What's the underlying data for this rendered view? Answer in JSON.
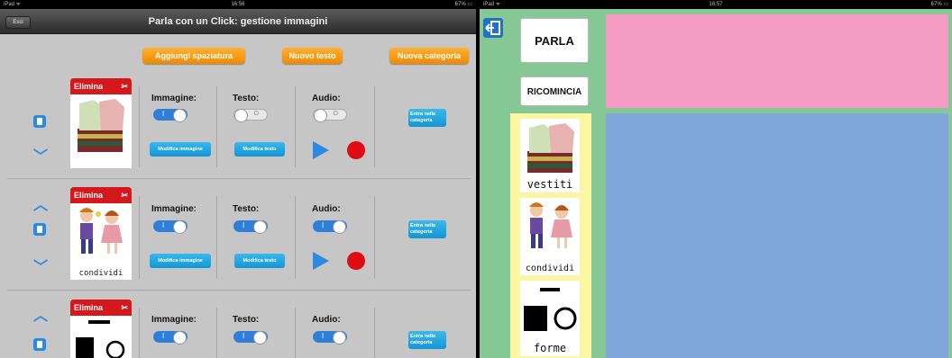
{
  "left": {
    "status": {
      "device": "iPad ᯤ",
      "time": "16:56",
      "battery": "67% ▭"
    },
    "navbar": {
      "title": "Parla con un Click: gestione immagini",
      "back": "Esci"
    },
    "actions": {
      "spacing": "Aggiungi spaziatura",
      "new_text": "Nuovo testo",
      "new_category": "Nuova categoria"
    },
    "labels": {
      "delete": "Elimina",
      "image": "Immagine:",
      "text": "Testo:",
      "audio": "Audio:",
      "edit_image": "Modifica immagine",
      "edit_text": "Modifica testo",
      "enter_category": "Entra nella categoria"
    },
    "rows": [
      {
        "caption": "",
        "image": "on",
        "text": "off",
        "audio": "off"
      },
      {
        "caption": "condividi",
        "image": "on",
        "text": "on",
        "audio": "on"
      },
      {
        "caption": "",
        "image": "on",
        "text": "on",
        "audio": "on"
      }
    ],
    "colors": {
      "accent": "#f08a00",
      "blue": "#2a8be0",
      "red": "#d4181c"
    }
  },
  "right": {
    "status": {
      "device": "iPad ᯤ",
      "time": "16:57",
      "battery": "67% ▭"
    },
    "speak": "PARLA",
    "restart": "RICOMINCIA",
    "tiles": [
      {
        "caption": "vestiti"
      },
      {
        "caption": "condividi"
      },
      {
        "caption": "forme"
      }
    ],
    "colors": {
      "background": "#85c895",
      "pink": "#f49cc3",
      "blue": "#7fa7d9",
      "yellow": "#fbf6a2"
    }
  }
}
